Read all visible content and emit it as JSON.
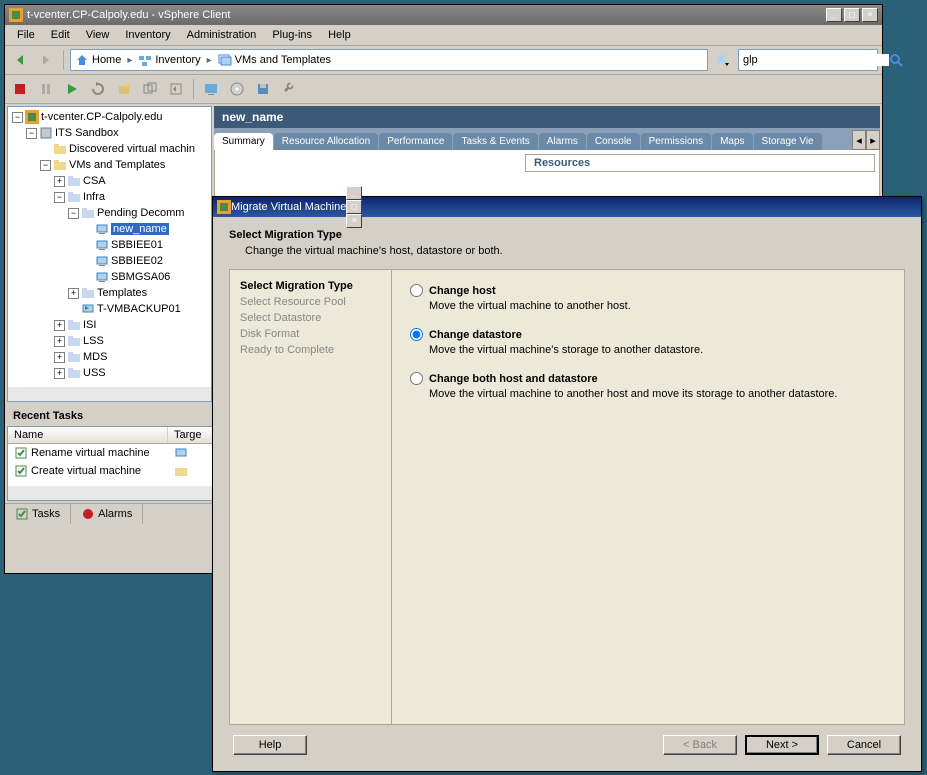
{
  "app_title": "t-vcenter.CP-Calpoly.edu - vSphere Client",
  "menus": [
    "File",
    "Edit",
    "View",
    "Inventory",
    "Administration",
    "Plug-ins",
    "Help"
  ],
  "breadcrumb": {
    "home": "Home",
    "inventory": "Inventory",
    "vms": "VMs and Templates"
  },
  "search_value": "glp",
  "tree": {
    "root": "t-vcenter.CP-Calpoly.edu",
    "datacenter": "ITS Sandbox",
    "discovered": "Discovered virtual machin",
    "vms_templates": "VMs and Templates",
    "csa": "CSA",
    "infra": "Infra",
    "pending": "Pending Decomm",
    "new_name": "new_name",
    "sbbiee01": "SBBIEE01",
    "sbbiee02": "SBBIEE02",
    "sbmgsa06": "SBMGSA06",
    "templates": "Templates",
    "tvmbackup": "T-VMBACKUP01",
    "isi": "ISI",
    "lss": "LSS",
    "mds": "MDS",
    "uss": "USS"
  },
  "content_title": "new_name",
  "tabs": [
    "Summary",
    "Resource Allocation",
    "Performance",
    "Tasks & Events",
    "Alarms",
    "Console",
    "Permissions",
    "Maps",
    "Storage Vie"
  ],
  "resources_label": "Resources",
  "recent_tasks_label": "Recent Tasks",
  "task_cols": {
    "name": "Name",
    "target": "Targe"
  },
  "tasks": [
    {
      "name": "Rename virtual machine"
    },
    {
      "name": "Create virtual machine"
    }
  ],
  "status_tabs": {
    "tasks": "Tasks",
    "alarms": "Alarms"
  },
  "dialog": {
    "title": "Migrate Virtual Machine",
    "heading": "Select Migration Type",
    "subhead": "Change the virtual machine's host, datastore or both.",
    "steps": [
      "Select Migration Type",
      "Select Resource Pool",
      "Select Datastore",
      "Disk Format",
      "Ready to Complete"
    ],
    "options": [
      {
        "label": "Change host",
        "desc": "Move the virtual machine to another host."
      },
      {
        "label": "Change datastore",
        "desc": "Move the virtual machine's storage to another datastore."
      },
      {
        "label": "Change both host and datastore",
        "desc": "Move the virtual machine to another host and move its storage to another datastore."
      }
    ],
    "buttons": {
      "help": "Help",
      "back": "< Back",
      "next": "Next >",
      "cancel": "Cancel"
    }
  }
}
